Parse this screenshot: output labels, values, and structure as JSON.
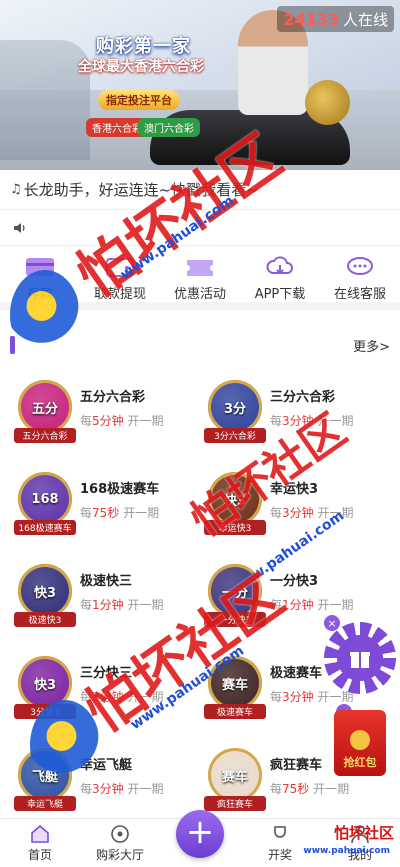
{
  "banner": {
    "title": "购彩第一家",
    "subtitle": "全球最大香港六合彩",
    "badge": "指定投注平台",
    "tag_left": "香港六合彩",
    "tag_right": "澳门六合彩"
  },
  "online": {
    "count": "24133",
    "label": "人在线"
  },
  "marquee": {
    "text": "长龙助手，好运连连~快戳我看看~"
  },
  "quick_menu": [
    {
      "label": "存款",
      "icon": "card-icon"
    },
    {
      "label": "取款提现",
      "icon": "wallet-icon"
    },
    {
      "label": "优惠活动",
      "icon": "ticket-icon"
    },
    {
      "label": "APP下载",
      "icon": "cloud-download-icon"
    },
    {
      "label": "在线客服",
      "icon": "chat-icon"
    }
  ],
  "section": {
    "more": "更多>"
  },
  "lotteries": [
    {
      "name": "五分六合彩",
      "prefix": "每",
      "period": "5分钟",
      "suffix": "开一期",
      "logo": "五分",
      "tag": "五分六合彩",
      "color": "#c51c7a"
    },
    {
      "name": "三分六合彩",
      "prefix": "每",
      "period": "3分钟",
      "suffix": "开一期",
      "logo": "3分",
      "tag": "3分六合彩",
      "color": "#2c3f9a"
    },
    {
      "name": "168极速赛车",
      "prefix": "每",
      "period": "75秒",
      "suffix": "开一期",
      "logo": "168",
      "tag": "168极速赛车",
      "color": "#5a2fa8"
    },
    {
      "name": "幸运快3",
      "prefix": "每",
      "period": "3分钟",
      "suffix": "开一期",
      "logo": "快3",
      "tag": "幸运快3",
      "color": "#6b2a10"
    },
    {
      "name": "极速快三",
      "prefix": "每",
      "period": "1分钟",
      "suffix": "开一期",
      "logo": "快3",
      "tag": "极速快3",
      "color": "#2d2a78"
    },
    {
      "name": "一分快3",
      "prefix": "每",
      "period": "1分钟",
      "suffix": "开一期",
      "logo": "一分",
      "tag": "一分快3",
      "color": "#3a2f7a"
    },
    {
      "name": "三分快三",
      "prefix": "每",
      "period": "3分钟",
      "suffix": "开一期",
      "logo": "快3",
      "tag": "3分快3",
      "color": "#7a1fa0"
    },
    {
      "name": "极速赛车",
      "prefix": "每",
      "period": "3分钟",
      "suffix": "开一期",
      "logo": "赛车",
      "tag": "极速赛车",
      "color": "#3b1f1f"
    },
    {
      "name": "幸运飞艇",
      "prefix": "每",
      "period": "3分钟",
      "suffix": "开一期",
      "logo": "飞艇",
      "tag": "幸运飞艇",
      "color": "#2a4fa0"
    },
    {
      "name": "疯狂赛车",
      "prefix": "每",
      "period": "75秒",
      "suffix": "开一期",
      "logo": "赛车",
      "tag": "疯狂赛车",
      "color": "#e8d9c8"
    }
  ],
  "redpack": {
    "label": "抢红包"
  },
  "tabbar": [
    {
      "label": "首页",
      "icon": "home-icon"
    },
    {
      "label": "购彩大厅",
      "icon": "lobby-icon"
    },
    {
      "label": "",
      "icon": "plus-icon"
    },
    {
      "label": "开奖",
      "icon": "trophy-icon"
    },
    {
      "label": "我的",
      "icon": "user-icon"
    }
  ],
  "watermark": {
    "text": "怕坏社区",
    "url": "www.pahuai.com"
  }
}
